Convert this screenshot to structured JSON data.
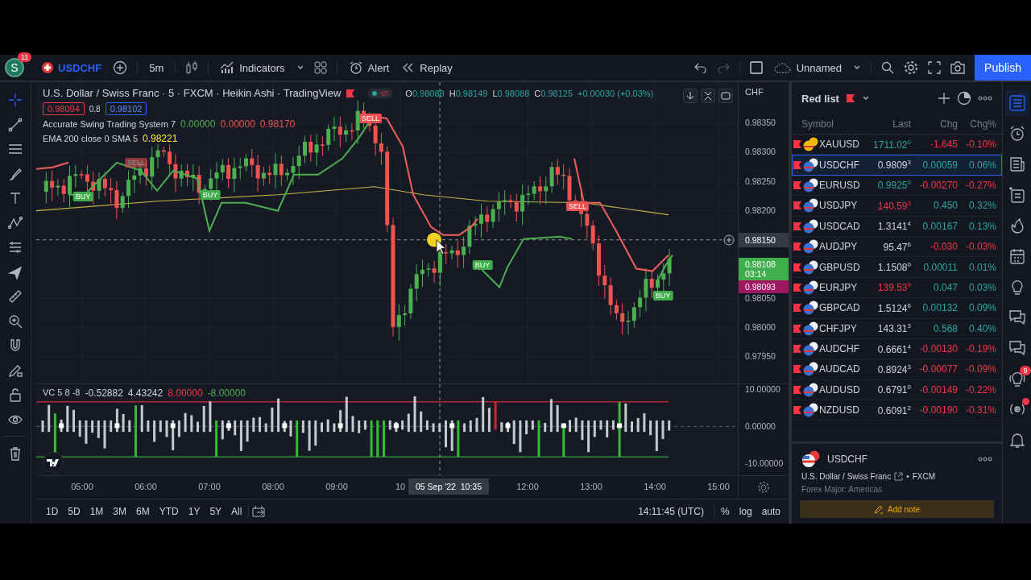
{
  "toolbar": {
    "avatar": "S",
    "notifications": "11",
    "symbol": "USDCHF",
    "interval": "5m",
    "indicators": "Indicators",
    "alert": "Alert",
    "replay": "Replay",
    "layout": "Unnamed",
    "publish": "Publish"
  },
  "chart": {
    "title": "U.S. Dollar / Swiss Franc · 5 · FXCM · Heikin Ashi · TradingView",
    "ohlc": [
      {
        "label": "O",
        "value": "0.98088"
      },
      {
        "label": "H",
        "value": "0.98149"
      },
      {
        "label": "L",
        "value": "0.98088"
      },
      {
        "label": "C",
        "value": "0.98125"
      }
    ],
    "change": "+0.00030 (+0.03%)",
    "sell": "0.98094",
    "spread": "0.8",
    "buy": "0.98102",
    "legends": [
      {
        "name": "Accurate Swing Trading System 7",
        "values": [
          {
            "text": "0.00000",
            "color": "#4caf50"
          },
          {
            "text": "0.00000",
            "color": "#ef5350"
          },
          {
            "text": "0.98170",
            "color": "#ef5350"
          }
        ]
      },
      {
        "name": "EMA 200 close 0 SMA 5",
        "values": [
          {
            "text": "0.98221",
            "color": "#ffeb3b"
          }
        ]
      }
    ],
    "signals": [
      {
        "kind": "sell",
        "label": "SELL"
      },
      {
        "kind": "sell",
        "label": "SELL"
      },
      {
        "kind": "buy",
        "label": "BUY"
      },
      {
        "kind": "buy",
        "label": "BUY"
      },
      {
        "kind": "sell",
        "label": "SELL"
      },
      {
        "kind": "buy",
        "label": "BUY"
      },
      {
        "kind": "buy",
        "label": "BUY"
      }
    ],
    "currency": "CHF",
    "price_ticks": [
      "0.98350",
      "0.98300",
      "0.98250",
      "0.98200",
      "0.98050",
      "0.98000",
      "0.97950"
    ],
    "crosshair_price": "0.98150",
    "last_price": "0.98108",
    "countdown": "03:14",
    "bid_price": "0.98093"
  },
  "oscillator": {
    "legend": "VC 5 8 -8",
    "values": [
      {
        "text": "-0.52882",
        "color": "#d1d4dc"
      },
      {
        "text": "4.43242",
        "color": "#d1d4dc"
      },
      {
        "text": "8.00000",
        "color": "#f23645"
      },
      {
        "text": "-8.00000",
        "color": "#4caf50"
      }
    ],
    "ticks": [
      "10.00000",
      "0.00000",
      "-10.00000"
    ]
  },
  "time_axis": {
    "ticks": [
      "05:00",
      "06:00",
      "07:00",
      "08:00",
      "09:00",
      "10",
      "12:00",
      "13:00",
      "14:00",
      "15:00"
    ],
    "crosshair_date": "05 Sep '22",
    "crosshair_time": "10:35"
  },
  "ranges": [
    "1D",
    "5D",
    "1M",
    "3M",
    "6M",
    "YTD",
    "1Y",
    "5Y",
    "All"
  ],
  "clock": "14:11:45 (UTC)",
  "scale_options": [
    "%",
    "log",
    "auto"
  ],
  "watchlist": {
    "title": "Red list",
    "columns": [
      "Symbol",
      "Last",
      "Chg",
      "Chg%"
    ],
    "rows": [
      {
        "symbol": "XAUUSD",
        "last": "1711.02",
        "last_pip": "0",
        "color": "#26a69a",
        "chg": "-1.645",
        "chg_pct": "-0.10%",
        "negative": true,
        "selected": false
      },
      {
        "symbol": "USDCHF",
        "last": "0.9809",
        "last_pip": "3",
        "color": "#d1d4dc",
        "chg": "0.00059",
        "chg_pct": "0.06%",
        "negative": false,
        "selected": true
      },
      {
        "symbol": "EURUSD",
        "last": "0.9925",
        "last_pip": "0",
        "color": "#26a69a",
        "chg": "-0.00270",
        "chg_pct": "-0.27%",
        "negative": true,
        "selected": false
      },
      {
        "symbol": "USDJPY",
        "last": "140.59",
        "last_pip": "3",
        "color": "#f23645",
        "chg": "0.450",
        "chg_pct": "0.32%",
        "negative": false,
        "selected": false
      },
      {
        "symbol": "USDCAD",
        "last": "1.3141",
        "last_pip": "4",
        "color": "#d1d4dc",
        "chg": "0.00167",
        "chg_pct": "0.13%",
        "negative": false,
        "selected": false
      },
      {
        "symbol": "AUDJPY",
        "last": "95.47",
        "last_pip": "6",
        "color": "#d1d4dc",
        "chg": "-0.030",
        "chg_pct": "-0.03%",
        "negative": true,
        "selected": false
      },
      {
        "symbol": "GBPUSD",
        "last": "1.1508",
        "last_pip": "0",
        "color": "#d1d4dc",
        "chg": "0.00011",
        "chg_pct": "0.01%",
        "negative": false,
        "selected": false
      },
      {
        "symbol": "EURJPY",
        "last": "139.53",
        "last_pip": "9",
        "color": "#f23645",
        "chg": "0.047",
        "chg_pct": "0.03%",
        "negative": false,
        "selected": false
      },
      {
        "symbol": "GBPCAD",
        "last": "1.5124",
        "last_pip": "6",
        "color": "#d1d4dc",
        "chg": "0.00132",
        "chg_pct": "0.09%",
        "negative": false,
        "selected": false
      },
      {
        "symbol": "CHFJPY",
        "last": "143.31",
        "last_pip": "3",
        "color": "#d1d4dc",
        "chg": "0.568",
        "chg_pct": "0.40%",
        "negative": false,
        "selected": false
      },
      {
        "symbol": "AUDCHF",
        "last": "0.6661",
        "last_pip": "4",
        "color": "#d1d4dc",
        "chg": "-0.00130",
        "chg_pct": "-0.19%",
        "negative": true,
        "selected": false
      },
      {
        "symbol": "AUDCAD",
        "last": "0.8924",
        "last_pip": "3",
        "color": "#d1d4dc",
        "chg": "-0.00077",
        "chg_pct": "-0.09%",
        "negative": true,
        "selected": false
      },
      {
        "symbol": "AUDUSD",
        "last": "0.6791",
        "last_pip": "0",
        "color": "#d1d4dc",
        "chg": "-0.00149",
        "chg_pct": "-0.22%",
        "negative": true,
        "selected": false
      },
      {
        "symbol": "NZDUSD",
        "last": "0.6091",
        "last_pip": "2",
        "color": "#d1d4dc",
        "chg": "-0.00190",
        "chg_pct": "-0.31%",
        "negative": true,
        "selected": false
      }
    ]
  },
  "details": {
    "symbol": "USDCHF",
    "name": "U.S. Dollar / Swiss Franc",
    "separator": "•",
    "exchange": "FXCM",
    "category": "Forex Major: Americas",
    "note_button": "Add note"
  },
  "sidebar_badge": "9"
}
